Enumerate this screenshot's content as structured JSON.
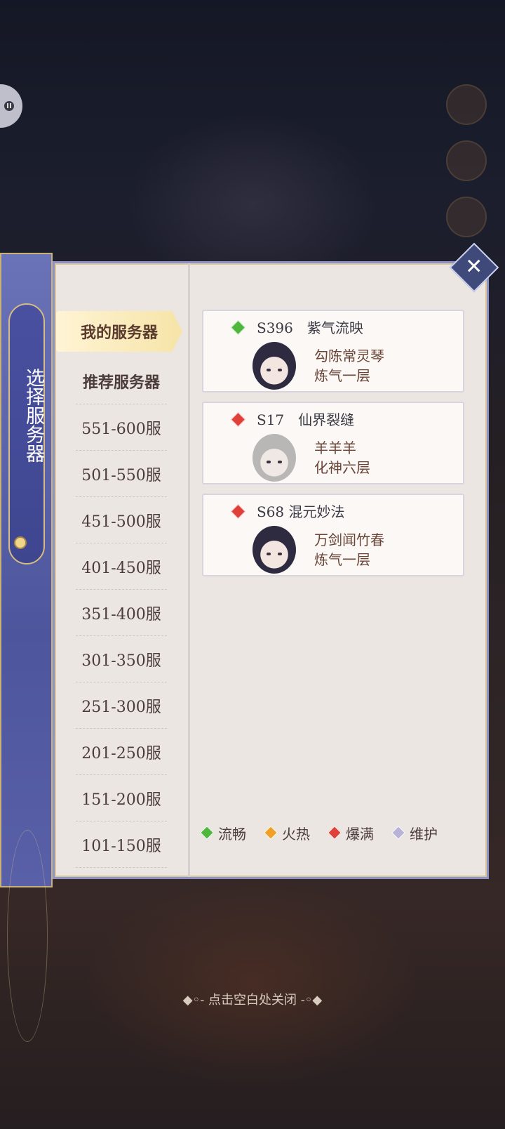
{
  "sidebar": {
    "title": "选择服务器"
  },
  "tabs": [
    {
      "label": "我的服务器",
      "active": true
    },
    {
      "label": "推荐服务器"
    },
    {
      "label": "551-600服"
    },
    {
      "label": "501-550服"
    },
    {
      "label": "451-500服"
    },
    {
      "label": "401-450服"
    },
    {
      "label": "351-400服"
    },
    {
      "label": "301-350服"
    },
    {
      "label": "251-300服"
    },
    {
      "label": "201-250服"
    },
    {
      "label": "151-200服"
    },
    {
      "label": "101-150服"
    }
  ],
  "servers": [
    {
      "name": "S396　紫气流映",
      "status_color": "#4fb83c",
      "character": "勾陈常灵琴",
      "level": "炼气一层"
    },
    {
      "name": "S17　仙界裂缝",
      "status_color": "#e0403a",
      "character": "羊羊羊",
      "level": "化神六层"
    },
    {
      "name": "S68 混元妙法",
      "status_color": "#e0403a",
      "character": "万剑闻竹春",
      "level": "炼气一层"
    }
  ],
  "legend": [
    {
      "label": "流畅",
      "color": "#4fb83c"
    },
    {
      "label": "火热",
      "color": "#f0a028"
    },
    {
      "label": "爆满",
      "color": "#e0403a"
    },
    {
      "label": "维护",
      "color": "#b9b3d8"
    }
  ],
  "close_hint": "◆◦- 点击空白处关闭 -◦◆"
}
